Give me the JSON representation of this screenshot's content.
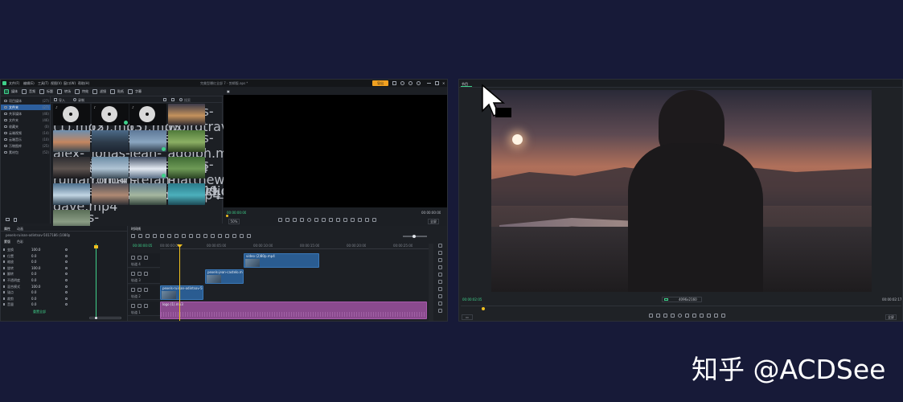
{
  "editor": {
    "menus": [
      "文件(F)",
      "编辑(E)",
      "工具(T)",
      "视图(V)",
      "窗口(W)",
      "帮助(H)"
    ],
    "title": "完美型爆红全部 7 - 剪辑版.aps *",
    "export_label": "导出",
    "toolbar": [
      {
        "label": "媒体",
        "active": true
      },
      {
        "label": "音频",
        "active": false
      },
      {
        "label": "标题",
        "active": false
      },
      {
        "label": "转场",
        "active": false
      },
      {
        "label": "特效",
        "active": false
      },
      {
        "label": "滤镜",
        "active": false
      },
      {
        "label": "贴纸",
        "active": false
      },
      {
        "label": "字幕",
        "active": false
      }
    ],
    "media_sidebar": [
      {
        "label": "项目媒体",
        "count": "(27)",
        "selected": false
      },
      {
        "label": "文件夹",
        "count": "(27)",
        "selected": true
      },
      {
        "label": "共享媒体",
        "count": "(46)",
        "selected": false
      },
      {
        "label": "文件夹",
        "count": "(46)",
        "selected": false
      },
      {
        "label": "收藏夹",
        "count": "(0)",
        "selected": false
      },
      {
        "label": "云端视频",
        "count": "(14)",
        "selected": false
      },
      {
        "label": "云端音乐",
        "count": "(10)",
        "selected": false
      },
      {
        "label": "万物图库",
        "count": "(25)",
        "selected": false
      },
      {
        "label": "素材包",
        "count": "(52)",
        "selected": false
      }
    ],
    "media_toolbar": {
      "import_label": "导入",
      "record_label": "录制",
      "search_label": "搜索"
    },
    "media_items": [
      {
        "label": "logo (1).mp3",
        "kind": "audio",
        "checked": false
      },
      {
        "label": "logo (2).mp3",
        "kind": "audio",
        "checked": true
      },
      {
        "label": "logo (3).mp3",
        "kind": "audio",
        "checked": false
      },
      {
        "label": "pexels-wolrdtrave.mp4",
        "kind": "video",
        "checked": false,
        "colors": [
          "#3b3a4a",
          "#c4925c",
          "#2e2a30"
        ]
      },
      {
        "label": "pexels-alex-florese.mp4",
        "kind": "video",
        "checked": false,
        "colors": [
          "#6c8fb0",
          "#c48660",
          "#3c4a54"
        ]
      },
      {
        "label": "pexels-jonas-santo.mp4",
        "kind": "video",
        "checked": false,
        "colors": [
          "#4c6a88",
          "#2d3b4a",
          "#1c2430"
        ]
      },
      {
        "label": "pexels-jean-castelo.mp4",
        "kind": "video",
        "checked": true,
        "colors": [
          "#5e7898",
          "#8aa6c0",
          "#2e3c4a"
        ]
      },
      {
        "label": "pexels-adolph.mp4",
        "kind": "video",
        "checked": false,
        "colors": [
          "#4f7a3a",
          "#8cb064",
          "#2d4420"
        ]
      },
      {
        "label": "pexels-ruinan.mp4",
        "kind": "video",
        "checked": false,
        "colors": [
          "#2c2c30",
          "#5e5450",
          "#1a1a1e"
        ]
      },
      {
        "label": "pexels-roman-odintsov.mp4",
        "kind": "video",
        "checked": false,
        "colors": [
          "#6a8aa4",
          "#b0c4d4",
          "#3a4a56"
        ]
      },
      {
        "label": "pexels-stefan-stefancik.mp4",
        "kind": "video",
        "checked": true,
        "colors": [
          "#3c4a60",
          "#e4eaf2",
          "#586c84"
        ]
      },
      {
        "label": "pexels-matthew.mp4",
        "kind": "video",
        "checked": false,
        "colors": [
          "#3e6a34",
          "#6e9a56",
          "#2a4224"
        ]
      },
      {
        "label": "pexels-dave.mp4",
        "kind": "video",
        "checked": false,
        "colors": [
          "#4a6e8c",
          "#c2d6e4",
          "#2c4050"
        ]
      },
      {
        "label": "production_id_4709.mp4",
        "kind": "video",
        "checked": false,
        "colors": [
          "#4a4c56",
          "#b08a74",
          "#2a2c32"
        ]
      },
      {
        "label": "production_id_4657.mp4",
        "kind": "video",
        "checked": false,
        "colors": [
          "#5e7a8c",
          "#a6b8a0",
          "#34443c"
        ]
      },
      {
        "label": "production_id_4652.mp4",
        "kind": "video",
        "checked": false,
        "colors": [
          "#2a7a8a",
          "#4cb0bc",
          "#1c4a56"
        ]
      },
      {
        "label": "pexels-anastasia.mp4",
        "kind": "video",
        "checked": false,
        "colors": [
          "#5a6e58",
          "#8a9c84",
          "#34423a"
        ]
      }
    ],
    "preview": {
      "timecode_left": "00:00:00:00",
      "timecode_right": "00:00:00:00",
      "zoom": "50%",
      "quality": "全屏"
    },
    "inspector": {
      "tabs": [
        "属性",
        "动画",
        "蒙版",
        "色彩"
      ],
      "clip_name": "pexels-ruinan-odintsov-5017186 (1080p)",
      "sections": [
        "变换",
        "位置",
        "缩放",
        "旋转",
        "翻转",
        "不透明度",
        "混合模式",
        "锚点",
        "裁剪",
        "音量"
      ],
      "values": [
        "100.0",
        "0.0",
        "0.0",
        "100.0",
        "0.0",
        "0.0",
        "100.0",
        "0.0",
        "0.0",
        "0.0"
      ],
      "reset_label": "重置全部"
    },
    "timeline": {
      "tab": "时间线",
      "timecode": "00:00:00:05",
      "ruler": [
        "00:00:00:00",
        "00:00:05:00",
        "00:00:10:00",
        "00:00:15:00",
        "00:00:20:00",
        "00:00:25:00"
      ],
      "tracks": [
        "轨道 4",
        "轨道 3",
        "轨道 2",
        "轨道 1"
      ],
      "clips": [
        {
          "label": "video (2)80p.mp4",
          "track": 0
        },
        {
          "label": "pexels-jean-castelo.mp4",
          "track": 1
        },
        {
          "label": "pexels-ruinan-odintsov-5017...",
          "track": 2
        },
        {
          "label": "logo (1).mp3",
          "track": 3
        }
      ]
    }
  },
  "viewer": {
    "tab": "节目",
    "timecode_left": "00:00:02:05",
    "timecode_right": "00:00:02:17",
    "resolution": "4096x2160",
    "quality": "全屏"
  },
  "watermark": "知乎 @ACDSee",
  "colors": {
    "background": "#171a38",
    "accent": "#3fd08a",
    "export": "#f0a020",
    "clip_blue": "#2a5c91",
    "audio_purple": "#8a4a8e"
  }
}
